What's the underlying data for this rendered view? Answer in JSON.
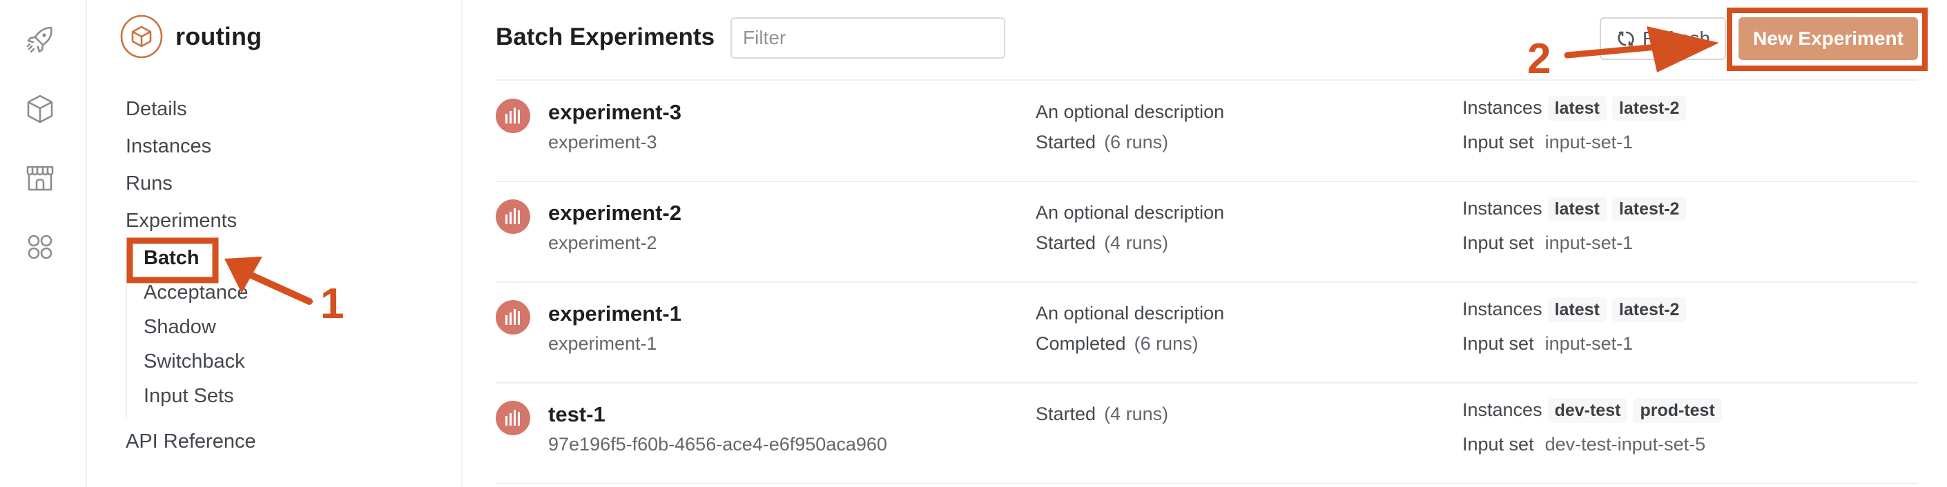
{
  "rail": {
    "items": [
      {
        "icon": "rocket-icon"
      },
      {
        "icon": "cube-icon"
      },
      {
        "icon": "storefront-icon"
      },
      {
        "icon": "apps-grid-icon"
      }
    ]
  },
  "app": {
    "name": "routing",
    "logo_icon": "cube-icon"
  },
  "nav": {
    "items": [
      {
        "label": "Details"
      },
      {
        "label": "Instances"
      },
      {
        "label": "Runs"
      },
      {
        "label": "Experiments"
      }
    ],
    "experiments_sub": [
      {
        "label": "Batch",
        "active": true
      },
      {
        "label": "Acceptance"
      },
      {
        "label": "Shadow"
      },
      {
        "label": "Switchback"
      },
      {
        "label": "Input Sets"
      }
    ],
    "api_reference": "API Reference"
  },
  "main": {
    "title": "Batch Experiments",
    "filter": {
      "placeholder": "Filter",
      "value": ""
    },
    "refresh_label": "Refresh",
    "new_experiment_label": "New Experiment",
    "instances_label": "Instances",
    "input_set_label": "Input set",
    "experiments": [
      {
        "name": "experiment-3",
        "id": "experiment-3",
        "description": "An optional description",
        "status": "Started",
        "runs": "(6 runs)",
        "instances": [
          "latest",
          "latest-2"
        ],
        "input_set": "input-set-1"
      },
      {
        "name": "experiment-2",
        "id": "experiment-2",
        "description": "An optional description",
        "status": "Started",
        "runs": "(4 runs)",
        "instances": [
          "latest",
          "latest-2"
        ],
        "input_set": "input-set-1"
      },
      {
        "name": "experiment-1",
        "id": "experiment-1",
        "description": "An optional description",
        "status": "Completed",
        "runs": "(6 runs)",
        "instances": [
          "latest",
          "latest-2"
        ],
        "input_set": "input-set-1"
      },
      {
        "name": "test-1",
        "id": "97e196f5-f60b-4656-ace4-e6f950aca960",
        "description": "",
        "status": "Started",
        "runs": "(4 runs)",
        "instances": [
          "dev-test",
          "prod-test"
        ],
        "input_set": "dev-test-input-set-5"
      }
    ]
  },
  "annotations": {
    "step1": "1",
    "step2": "2",
    "color": "#d4511f"
  },
  "colors": {
    "accent": "#d89873",
    "experiment_icon": "#d4776a",
    "logo": "#c8733f"
  }
}
